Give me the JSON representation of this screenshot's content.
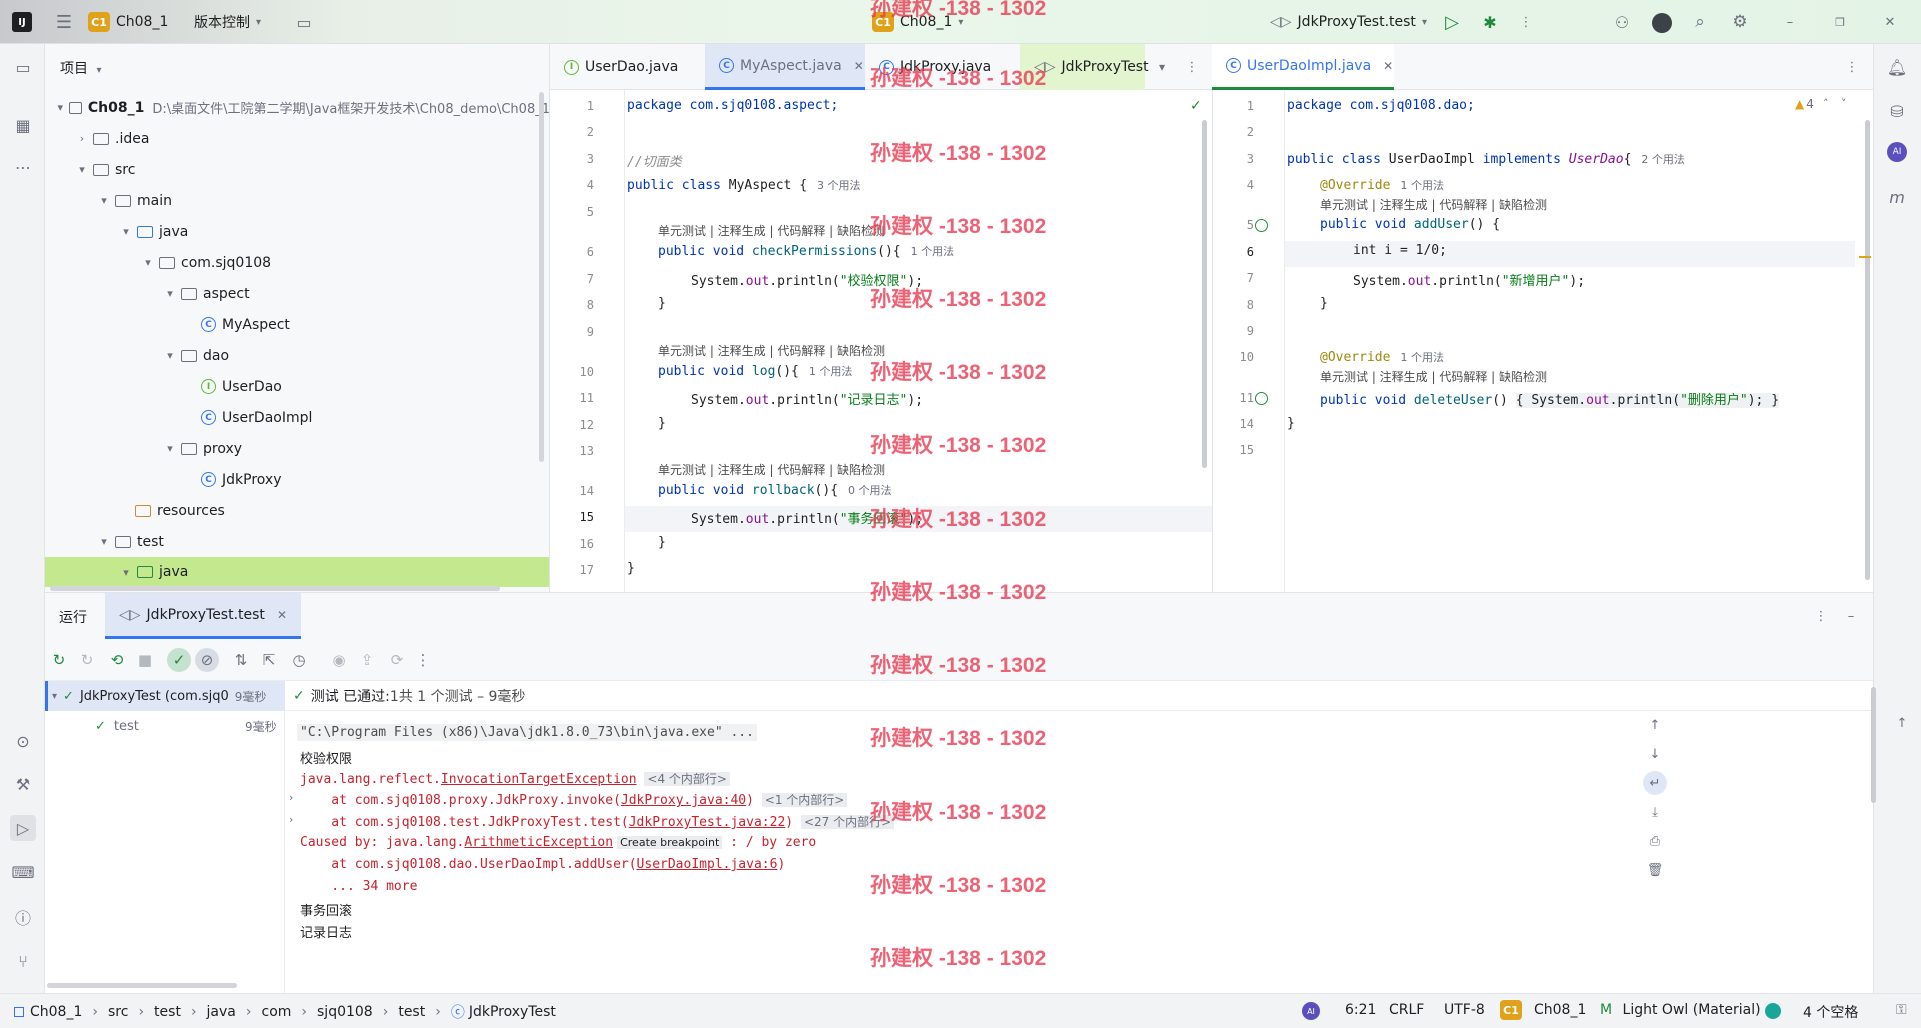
{
  "titlebar": {
    "project_badge": "C1",
    "project_name": "Ch08_1",
    "vcs": "版本控制",
    "center_project": "Ch08_1",
    "run_config": "JdkProxyTest.test"
  },
  "project_panel": {
    "title": "项目",
    "root_name": "Ch08_1",
    "root_path": "D:\\桌面文件\\工院第二学期\\Java框架开发技术\\Ch08_demo\\Ch08_1",
    "items": [
      {
        "label": ".idea"
      },
      {
        "label": "src"
      },
      {
        "label": "main"
      },
      {
        "label": "java"
      },
      {
        "label": "com.sjq0108"
      },
      {
        "label": "aspect"
      },
      {
        "label": "MyAspect"
      },
      {
        "label": "dao"
      },
      {
        "label": "UserDao"
      },
      {
        "label": "UserDaoImpl"
      },
      {
        "label": "proxy"
      },
      {
        "label": "JdkProxy"
      },
      {
        "label": "resources"
      },
      {
        "label": "test"
      },
      {
        "label": "java"
      }
    ]
  },
  "editor_left": {
    "tabs": [
      "UserDao.java",
      "MyAspect.java",
      "JdkProxy.java",
      "JdkProxyTest"
    ],
    "line_numbers": [
      "1",
      "2",
      "3",
      "4",
      "5",
      "6",
      "7",
      "8",
      "9",
      "10",
      "11",
      "12",
      "13",
      "14",
      "15",
      "16",
      "17"
    ],
    "code": {
      "l1": "package com.sjq0108.aspect;",
      "l3": "//切面类",
      "l4a": "public class ",
      "l4b": "MyAspect {",
      "l4u": "3 个用法",
      "hint": "单元测试 | 注释生成 | 代码解释 | 缺陷检测",
      "l6a": "public void ",
      "l6b": "checkPermissions",
      "l6c": "(){",
      "l6u": "1 个用法",
      "l7a": "System.",
      "l7b": "out",
      "l7c": ".println(",
      "l7d": "\"校验权限\"",
      "l7e": ");",
      "close": "}",
      "l10a": "public void ",
      "l10b": "log",
      "l10c": "(){",
      "l10u": "1 个用法",
      "l11d": "\"记录日志\"",
      "l14a": "public void ",
      "l14b": "rollback",
      "l14c": "(){",
      "l14u": "0 个用法",
      "l15d": "\"事务回滚\""
    }
  },
  "editor_right": {
    "tab": "UserDaoImpl.java",
    "warnings": "4",
    "line_numbers": [
      "1",
      "2",
      "3",
      "4",
      "5",
      "6",
      "7",
      "8",
      "9",
      "10",
      "11",
      "14",
      "15"
    ],
    "code": {
      "l1": "package com.sjq0108.dao;",
      "l3a": "public class ",
      "l3b": "UserDaoImpl ",
      "l3c": "implements ",
      "l3d": "UserDao",
      "l3e": "{",
      "l3u": "2 个用法",
      "override": "@Override",
      "ou": "1 个用法",
      "hint": "单元测试 | 注释生成 | 代码解释 | 缺陷检测",
      "l5a": "public void ",
      "l5b": "addUser",
      "l5c": "() {",
      "l6": "int i = 1/0;",
      "l7a": "System.",
      "l7b": "out",
      "l7c": ".println(",
      "l7d": "\"新增用户\"",
      "l7e": ");",
      "close": "}",
      "l11a": "public void ",
      "l11b": "deleteUser",
      "l11c": "() ",
      "l11d": "{ System.",
      "l11e": "out",
      "l11f": ".println(",
      "l11g": "\"删除用户\"",
      "l11h": "); }"
    }
  },
  "run_panel": {
    "tab_run": "运行",
    "tab_test": "JdkProxyTest.test",
    "tree_root": "JdkProxyTest (com.sjq0",
    "tree_root_time": "9毫秒",
    "tree_child": "test",
    "tree_child_time": "9毫秒",
    "status_a": "测试 已通过: ",
    "status_b": "1共 1 个测试 – 9毫秒",
    "console": {
      "c1": "\"C:\\Program Files (x86)\\Java\\jdk1.8.0_73\\bin\\java.exe\" ...",
      "c2": "校验权限",
      "c3a": "java.lang.reflect.",
      "c3b": "InvocationTargetException",
      "c3c": "<4 个内部行>",
      "c4a": "    at com.sjq0108.proxy.JdkProxy.invoke(",
      "c4b": "JdkProxy.java:40",
      "c4c": ")",
      "c4d": "<1 个内部行>",
      "c5a": "    at com.sjq0108.test.JdkProxyTest.test(",
      "c5b": "JdkProxyTest.java:22",
      "c5c": ")",
      "c5d": "<27 个内部行>",
      "c6a": "Caused by: java.lang.",
      "c6b": "ArithmeticException",
      "c6c": "Create breakpoint",
      "c6d": " : / by zero",
      "c7a": "    at com.sjq0108.dao.UserDaoImpl.addUser(",
      "c7b": "UserDaoImpl.java:6",
      "c7c": ")",
      "c8": "    ... 34 more",
      "c9": "事务回滚",
      "c10": "记录日志"
    }
  },
  "statusbar": {
    "crumbs": [
      "Ch08_1",
      "src",
      "test",
      "java",
      "com",
      "sjq0108",
      "test",
      "JdkProxyTest"
    ],
    "position": "6:21",
    "line_sep": "CRLF",
    "encoding": "UTF-8",
    "badge": "C1",
    "project": "Ch08_1",
    "theme": "Light Owl (Material)",
    "indent": "4 个空格"
  },
  "watermark": "孙建权 -138 - 1302",
  "colors": {
    "accent": "#3574f0",
    "selection": "#c3e88d",
    "error": "#c7222d",
    "badge": "#e0a11b"
  }
}
